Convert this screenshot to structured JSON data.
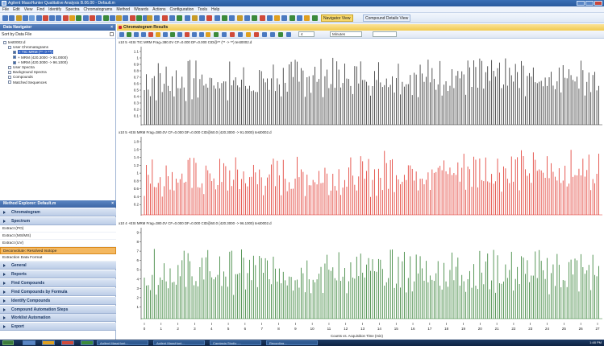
{
  "app": {
    "title": "Agilent MassHunter Qualitative Analysis B.06.00 - Default.m"
  },
  "menu": [
    "File",
    "Edit",
    "View",
    "Find",
    "Identify",
    "Spectra",
    "Chromatograms",
    "Method",
    "Wizards",
    "Actions",
    "Configuration",
    "Tools",
    "Help"
  ],
  "toolbar": {
    "navigator_label": "Navigator View",
    "compound_label": "Compound Details View"
  },
  "data_navigator": {
    "title": "Data Navigator",
    "sort_label": "Sort by Data File",
    "tree": [
      {
        "label": "test0002.d",
        "level": 0
      },
      {
        "label": "User Chromatograms",
        "level": 1
      },
      {
        "label": "+ TIC MRM (** -> **)",
        "level": 2,
        "selected": true
      },
      {
        "label": "+ MRM (420.3000 -> 91.0000)",
        "level": 2
      },
      {
        "label": "+ MRM (420.3000 -> 96.1000)",
        "level": 2
      },
      {
        "label": "User Spectra",
        "level": 1
      },
      {
        "label": "Background Spectra",
        "level": 1
      },
      {
        "label": "Compounds",
        "level": 1
      },
      {
        "label": "Matched Sequences",
        "level": 1
      }
    ]
  },
  "method_explorer": {
    "title": "Method Explorer: Default.m",
    "sections_top": [
      "Chromatogram",
      "Spectrum"
    ],
    "items": [
      "Extract (PO)",
      "Extract (MS/MS)",
      "Extract (UV)",
      "Deconvolute: Resolved Isotope",
      "Extraction Data Format"
    ],
    "highlighted_item": "Deconvolute: Resolved Isotope",
    "sections_bottom": [
      "General",
      "Reports",
      "Find Compounds",
      "Find Compounds by Formula",
      "Identify Compounds",
      "Compound Automation Steps",
      "Worklist Automation",
      "Export"
    ]
  },
  "chromatogram_results": {
    "title": "Chromatogram Results",
    "zoom_value": "4",
    "units": "Minutes",
    "x_axis_label": "Counts vs. Acquisition Time (min)",
    "x_ticks": [
      "0",
      "1",
      "2",
      "3",
      "4",
      "5",
      "6",
      "7",
      "8",
      "9",
      "10",
      "11",
      "12",
      "13",
      "14",
      "15",
      "16",
      "17",
      "18",
      "19",
      "20",
      "21",
      "22",
      "23",
      "24",
      "25",
      "26",
      "27"
    ],
    "panels": [
      {
        "name": "tic",
        "title": "x10 5  +ESI TIC MRM Frag=380.0V CF=0.000 DF=0.000 CID@** (** -> **) test0002.d",
        "color": "#2a2a2a",
        "y_ticks": [
          "1.1",
          "1",
          "0.9",
          "0.8",
          "0.7",
          "0.6",
          "0.5",
          "0.4",
          "0.3",
          "0.2",
          "0.1"
        ],
        "y_top": 1.2
      },
      {
        "name": "mrm91",
        "title": "x10 5  +ESI MRM Frag=380.0V CF=0.000 DF=0.000 CID@60.0 (420.3000 -> 91.0000) test0002.d",
        "color": "#e0332a",
        "y_ticks": [
          "1.8",
          "1.6",
          "1.4",
          "1.2",
          "1",
          "0.8",
          "0.6",
          "0.4",
          "0.2"
        ],
        "y_top": 2.0
      },
      {
        "name": "mrm96",
        "title": "x10 4  +ESI MRM Frag=380.0V CF=0.000 DF=0.000 CID@60.0 (420.3000 -> 96.1000) test0002.d",
        "color": "#2f7d2f",
        "y_ticks": [
          "9",
          "8",
          "7",
          "6",
          "5",
          "4",
          "3",
          "2",
          "1"
        ],
        "y_top": 9.5
      }
    ]
  },
  "taskbar": {
    "items": [
      "Agilent MassHunt...",
      "Agilent MassHunt...",
      "Camtasia Studio -...",
      "Recording..."
    ],
    "clock": "1:48 PM"
  },
  "colors": {
    "accent": "#3e67a6",
    "highlight": "#f4b860",
    "tic": "#2a2a2a",
    "red": "#e0332a",
    "green": "#2f7d2f"
  }
}
